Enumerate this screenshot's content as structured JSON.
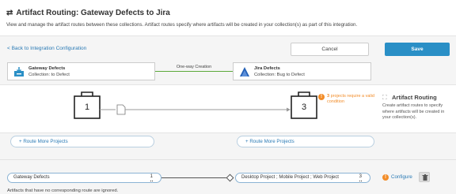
{
  "header": {
    "title": "Artifact Routing: Gateway Defects to Jira",
    "subtitle": "View and manage the artifact routes between these collections. Artifact routes specify where artifacts will be created in your collection(s) as part of this integration."
  },
  "toolbar": {
    "back_label": "< Back to Integration Configuration",
    "cancel_label": "Cancel",
    "save_label": "Save"
  },
  "source": {
    "name": "Gateway Defects",
    "collection": "Collection: to Defect"
  },
  "flow_label": "One-way Creation",
  "target": {
    "name": "Jira Defects",
    "collection": "Collection: Bug to Defect"
  },
  "diagram": {
    "source_count": "1",
    "target_count": "3",
    "warning_count": "3",
    "warning_text": "projects require a valid condition"
  },
  "artifact_routing": {
    "title": "Artifact Routing",
    "description": "Create artifact routes to specify where artifacts will be created in your collection(s)."
  },
  "route_more": {
    "left_label": "+ Route More Projects",
    "right_label": "+ Route More Projects"
  },
  "route": {
    "source_label": "Gateway Defects",
    "source_count": "1",
    "target_label": "Desktop Project ; Mobile Project ; Web Project",
    "target_count": "3",
    "configure_label": "Configure"
  },
  "footnote": "Artifacts that have no corresponding route are ignored.",
  "colors": {
    "accent": "#2a8fc6",
    "warning": "#f28c28",
    "flow": "#5ca93a",
    "link": "#2a7ab5"
  }
}
